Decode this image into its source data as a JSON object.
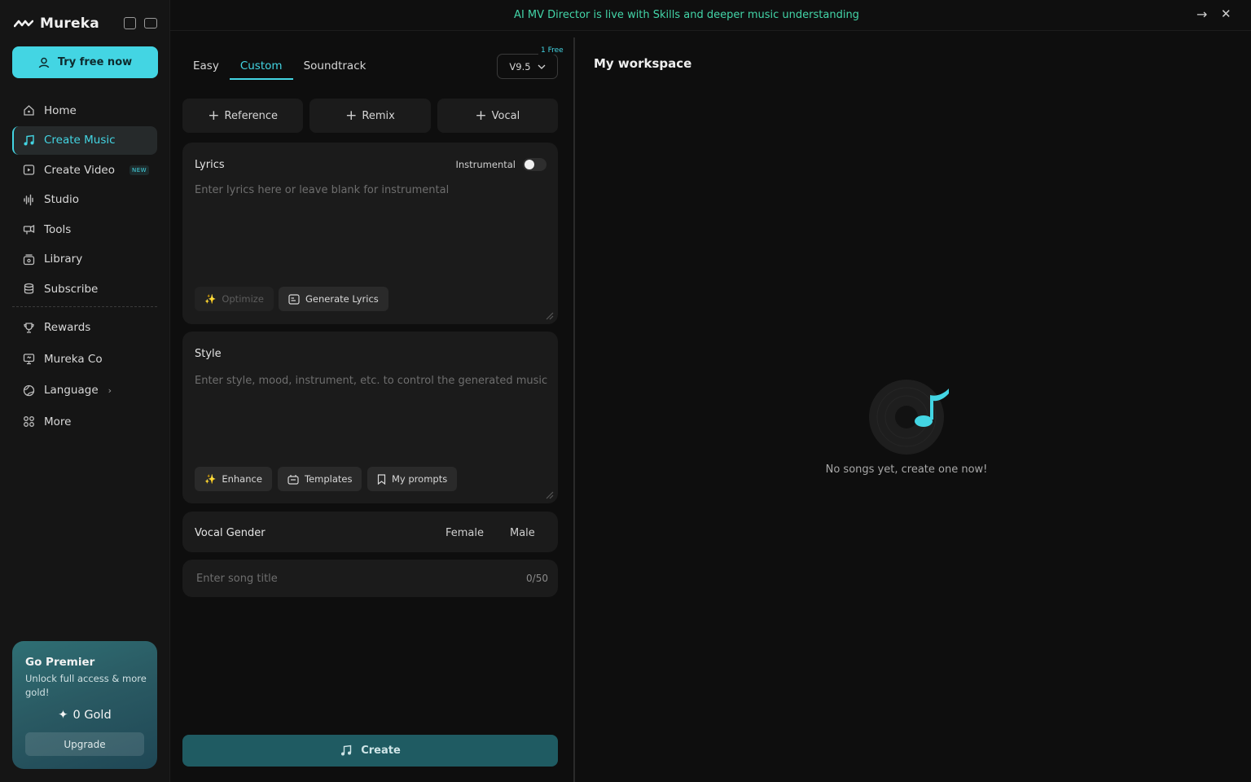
{
  "app": {
    "name": "Mureka"
  },
  "sidebar": {
    "try_button": "Try free now",
    "nav": [
      {
        "label": "Home",
        "icon": "home-icon"
      },
      {
        "label": "Create Music",
        "icon": "music-note-icon",
        "active": true
      },
      {
        "label": "Create Video",
        "icon": "video-icon",
        "badge": "NEW"
      },
      {
        "label": "Studio",
        "icon": "waveform-icon"
      },
      {
        "label": "Tools",
        "icon": "tools-icon"
      },
      {
        "label": "Library",
        "icon": "library-icon"
      },
      {
        "label": "Subscribe",
        "icon": "coins-icon"
      }
    ],
    "nav2": [
      {
        "label": "Rewards",
        "icon": "trophy-icon"
      },
      {
        "label": "Mureka Co",
        "icon": "monitor-icon"
      },
      {
        "label": "Language",
        "icon": "globe-icon"
      },
      {
        "label": "More",
        "icon": "grid-icon"
      }
    ],
    "premier": {
      "title": "Go Premier",
      "subtitle": "Unlock full access & more gold!",
      "gold": "0 Gold",
      "upgrade": "Upgrade"
    }
  },
  "banner": {
    "text": "AI MV Director is live with Skills and deeper music understanding"
  },
  "create": {
    "tabs": [
      "Easy",
      "Custom",
      "Soundtrack"
    ],
    "version": "V9.5",
    "version_badge": "1 Free",
    "chips": [
      "Reference",
      "Remix",
      "Vocal"
    ],
    "lyrics": {
      "label": "Lyrics",
      "instrumental_label": "Instrumental",
      "placeholder": "Enter lyrics here or leave blank for instrumental",
      "optimize": "Optimize",
      "generate": "Generate Lyrics"
    },
    "style": {
      "label": "Style",
      "placeholder": "Enter style, mood, instrument, etc. to control the generated music",
      "enhance": "Enhance",
      "templates": "Templates",
      "prompts": "My prompts"
    },
    "vocal_gender": {
      "label": "Vocal Gender",
      "female": "Female",
      "male": "Male"
    },
    "song_title": {
      "placeholder": "Enter song title",
      "count": "0/50"
    },
    "create_button": "Create"
  },
  "workspace": {
    "title": "My workspace",
    "empty": "No songs yet, create one now!"
  },
  "colors": {
    "accent": "#43d5e3",
    "banner": "#43d5a8",
    "create": "#1f5b62"
  }
}
